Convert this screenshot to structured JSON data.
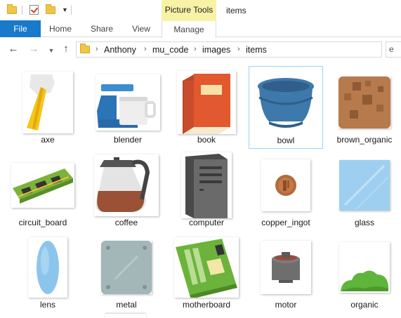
{
  "window": {
    "title": "items",
    "contextual_tab_group": "Picture Tools"
  },
  "quick_access": {
    "icons": [
      "folder-icon",
      "properties-check-icon",
      "new-folder-icon",
      "customize-dropdown-icon"
    ]
  },
  "ribbon": {
    "tabs": [
      "File",
      "Home",
      "Share",
      "View",
      "Manage"
    ],
    "active_tab_color": "#1979ca",
    "contextual_color": "#f7f2a5"
  },
  "navigation": {
    "back": "←",
    "forward": "→",
    "recent": "⌄",
    "up": "↑",
    "breadcrumb": [
      "Anthony",
      "mu_code",
      "images",
      "items"
    ],
    "separator": "›",
    "search_partial": "e"
  },
  "files": [
    {
      "name": "axe",
      "icon": "axe-thumbnail",
      "selected": false
    },
    {
      "name": "blender",
      "icon": "blender-thumbnail",
      "selected": false
    },
    {
      "name": "book",
      "icon": "book-thumbnail",
      "selected": false
    },
    {
      "name": "bowl",
      "icon": "bowl-thumbnail",
      "selected": true
    },
    {
      "name": "brown_organic",
      "icon": "brown-organic-thumbnail",
      "selected": false
    },
    {
      "name": "circuit_board",
      "icon": "circuit-board-thumbnail",
      "selected": false
    },
    {
      "name": "coffee",
      "icon": "coffee-thumbnail",
      "selected": false
    },
    {
      "name": "computer",
      "icon": "computer-thumbnail",
      "selected": false
    },
    {
      "name": "copper_ingot",
      "icon": "copper-ingot-thumbnail",
      "selected": false
    },
    {
      "name": "glass",
      "icon": "glass-thumbnail",
      "selected": false
    },
    {
      "name": "lens",
      "icon": "lens-thumbnail",
      "selected": false
    },
    {
      "name": "metal",
      "icon": "metal-thumbnail",
      "selected": false
    },
    {
      "name": "motherboard",
      "icon": "motherboard-thumbnail",
      "selected": false
    },
    {
      "name": "motor",
      "icon": "motor-thumbnail",
      "selected": false
    },
    {
      "name": "organic",
      "icon": "organic-thumbnail",
      "selected": false
    }
  ],
  "selection_color": "#99d1ff"
}
